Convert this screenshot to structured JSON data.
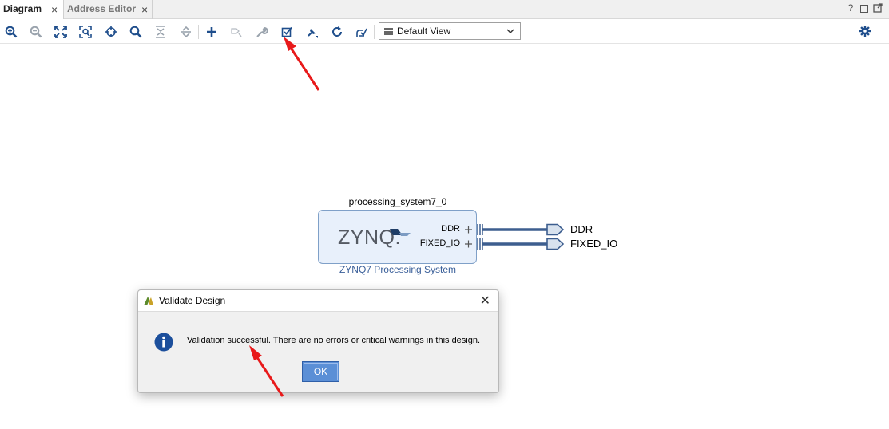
{
  "tabs": [
    {
      "label": "Diagram",
      "active": true
    },
    {
      "label": "Address Editor",
      "active": false
    }
  ],
  "window_controls": [
    "help-icon",
    "restore-icon",
    "float-icon"
  ],
  "toolbar": {
    "buttons": [
      "zoom-in-icon",
      "zoom-out-icon",
      "zoom-fit-icon",
      "zoom-selection-icon",
      "center-icon",
      "search-icon",
      "collapse-all-icon",
      "expand-all-icon",
      "add-ip-icon",
      "make-external-icon",
      "properties-icon",
      "validate-design-icon",
      "regenerate-layout-icon",
      "refresh-icon",
      "optimize-routing-icon"
    ],
    "view_select": "Default View",
    "settings_icon": "gear-icon"
  },
  "diagram": {
    "ip_instance_name": "processing_system7_0",
    "ip_logo_text": "ZYNQ.",
    "ip_ports": [
      "DDR",
      "FIXED_IO"
    ],
    "ip_description": "ZYNQ7 Processing System",
    "external_ports": [
      "DDR",
      "FIXED_IO"
    ],
    "colors": {
      "ip_fill": "#e8f0fb",
      "ip_border": "#7fa0c8",
      "wire": "#3d5e8f"
    }
  },
  "dialog": {
    "title": "Validate Design",
    "message": "Validation successful. There are no errors or critical warnings in this design.",
    "ok_label": "OK",
    "icon": "info-icon",
    "close_icon": "close-icon"
  },
  "annotations": {
    "arrow_color": "#e8191a"
  }
}
